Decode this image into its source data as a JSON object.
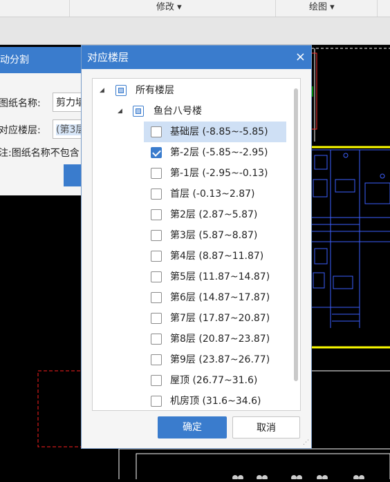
{
  "toolbar": {
    "modify": "修改 ▾",
    "draw": "绘图 ▾"
  },
  "bg_dialog": {
    "title": "动分割",
    "name_label": "图纸名称:",
    "name_value": "剪力墙",
    "floor_label": "对应楼层:",
    "floor_value": "(第3层",
    "note": "注:图纸名称不包含"
  },
  "dialog": {
    "title": "对应楼层",
    "close": "×",
    "ok": "确定",
    "cancel": "取消",
    "tree": {
      "root": {
        "label": "所有楼层",
        "arrow": "◢"
      },
      "building": {
        "label": "鱼台八号楼",
        "arrow": "◢"
      },
      "floors": [
        {
          "label": "基础层 (-8.85~-5.85)",
          "checked": false
        },
        {
          "label": "第-2层 (-5.85~-2.95)",
          "checked": true
        },
        {
          "label": "第-1层 (-2.95~-0.13)",
          "checked": false
        },
        {
          "label": "首层 (-0.13~2.87)",
          "checked": false
        },
        {
          "label": "第2层 (2.87~5.87)",
          "checked": false
        },
        {
          "label": "第3层 (5.87~8.87)",
          "checked": false
        },
        {
          "label": "第4层 (8.87~11.87)",
          "checked": false
        },
        {
          "label": "第5层 (11.87~14.87)",
          "checked": false
        },
        {
          "label": "第6层 (14.87~17.87)",
          "checked": false
        },
        {
          "label": "第7层 (17.87~20.87)",
          "checked": false
        },
        {
          "label": "第8层 (20.87~23.87)",
          "checked": false
        },
        {
          "label": "第9层 (23.87~26.77)",
          "checked": false
        },
        {
          "label": "屋顶 (26.77~31.6)",
          "checked": false
        },
        {
          "label": "机房顶 (31.6~34.6)",
          "checked": false
        }
      ]
    }
  }
}
